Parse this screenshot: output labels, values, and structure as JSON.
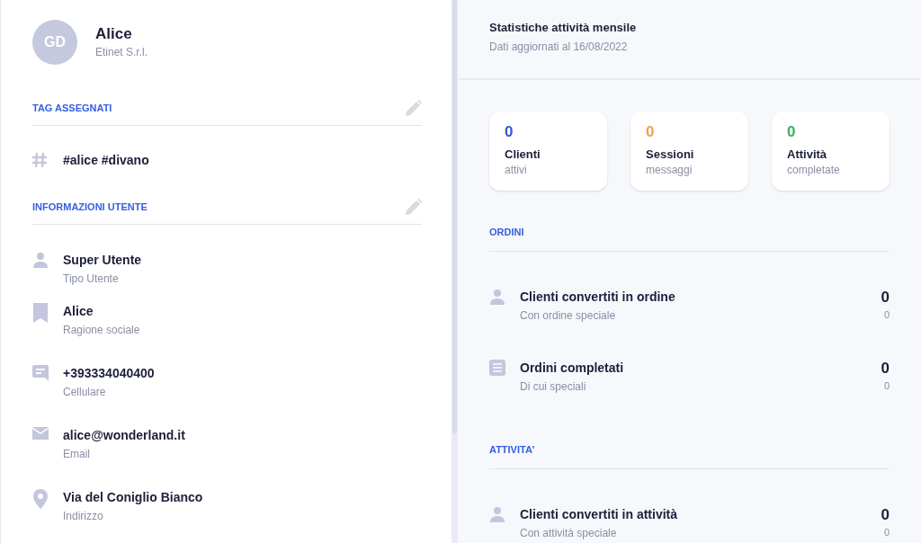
{
  "profile": {
    "initials": "GD",
    "name": "Alice",
    "company": "Etinet S.r.l."
  },
  "tags_section": {
    "title": "TAG ASSEGNATI",
    "tags": "#alice #divano"
  },
  "user_info_section": {
    "title": "INFORMAZIONI UTENTE",
    "items": [
      {
        "kind": "person",
        "value": "Super Utente",
        "label": "Tipo Utente"
      },
      {
        "kind": "bookmark",
        "value": "Alice",
        "label": "Ragione sociale"
      },
      {
        "kind": "chat",
        "value": "+393334040400",
        "label": "Cellulare"
      },
      {
        "kind": "mail",
        "value": "alice@wonderland.it",
        "label": "Email"
      },
      {
        "kind": "pin",
        "value": "Via del Coniglio Bianco",
        "label": "Indirizzo"
      }
    ]
  },
  "stats": {
    "title": "Statistiche attività mensile",
    "subtitle": "Dati aggiornati al 16/08/2022",
    "cards": [
      {
        "value": "0",
        "color": "#2f5bd9",
        "label": "Clienti",
        "sublabel": "attivi"
      },
      {
        "value": "0",
        "color": "#f0a04b",
        "label": "Sessioni",
        "sublabel": "messaggi"
      },
      {
        "value": "0",
        "color": "#3bb25a",
        "label": "Attività",
        "sublabel": "completate"
      }
    ],
    "sections": [
      {
        "title": "ORDINI",
        "rows": [
          {
            "kind": "person",
            "label": "Clienti convertiti in ordine",
            "sublabel": "Con ordine speciale",
            "value": "0",
            "subvalue": "0"
          },
          {
            "kind": "list",
            "label": "Ordini completati",
            "sublabel": "Di cui speciali",
            "value": "0",
            "subvalue": "0"
          }
        ]
      },
      {
        "title": "ATTIVITA'",
        "rows": [
          {
            "kind": "person",
            "label": "Clienti convertiti in attività",
            "sublabel": "Con attività speciale",
            "value": "0",
            "subvalue": "0"
          }
        ]
      }
    ]
  }
}
